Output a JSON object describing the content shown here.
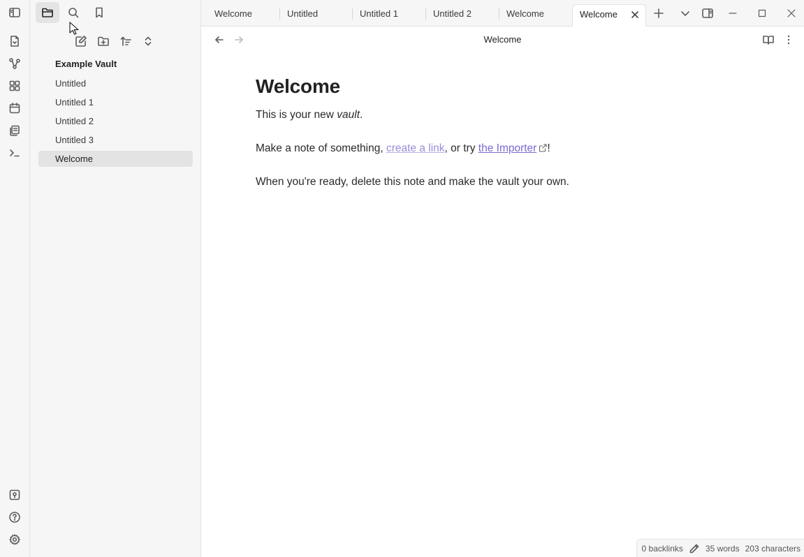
{
  "ribbon": {
    "top_icons": [
      "sidebar-toggle-icon",
      "open-quick-switcher-icon",
      "graph-view-icon",
      "canvas-icon",
      "daily-note-icon",
      "templates-icon",
      "command-palette-icon"
    ],
    "bottom_icons": [
      "vault-switcher-icon",
      "help-icon",
      "settings-icon"
    ]
  },
  "sidebar": {
    "tabs": [
      "files-tab",
      "search-tab",
      "bookmarks-tab"
    ],
    "active_tab": "files-tab",
    "vault_name": "Example Vault",
    "files": [
      {
        "label": "Untitled",
        "active": false
      },
      {
        "label": "Untitled 1",
        "active": false
      },
      {
        "label": "Untitled 2",
        "active": false
      },
      {
        "label": "Untitled 3",
        "active": false
      },
      {
        "label": "Welcome",
        "active": true
      }
    ]
  },
  "tabs": [
    {
      "label": "Welcome",
      "active": false
    },
    {
      "label": "Untitled",
      "active": false
    },
    {
      "label": "Untitled 1",
      "active": false
    },
    {
      "label": "Untitled 2",
      "active": false
    },
    {
      "label": "Welcome",
      "active": false
    },
    {
      "label": "Welcome",
      "active": true
    }
  ],
  "view": {
    "title": "Welcome"
  },
  "note": {
    "heading": "Welcome",
    "p1_before": "This is your new ",
    "p1_em": "vault",
    "p1_after": ".",
    "p2_before": "Make a note of something, ",
    "p2_link1": "create a link",
    "p2_middle": ", or try ",
    "p2_link2": "the Importer",
    "p2_after": "!",
    "p3": "When you're ready, delete this note and make the vault your own."
  },
  "status": {
    "backlinks": "0 backlinks",
    "words": "35 words",
    "characters": "203 characters"
  },
  "colors": {
    "accent_link": "#7b6bd0",
    "internal_link": "#9b8cd8",
    "sidebar_bg": "#f6f6f6"
  }
}
